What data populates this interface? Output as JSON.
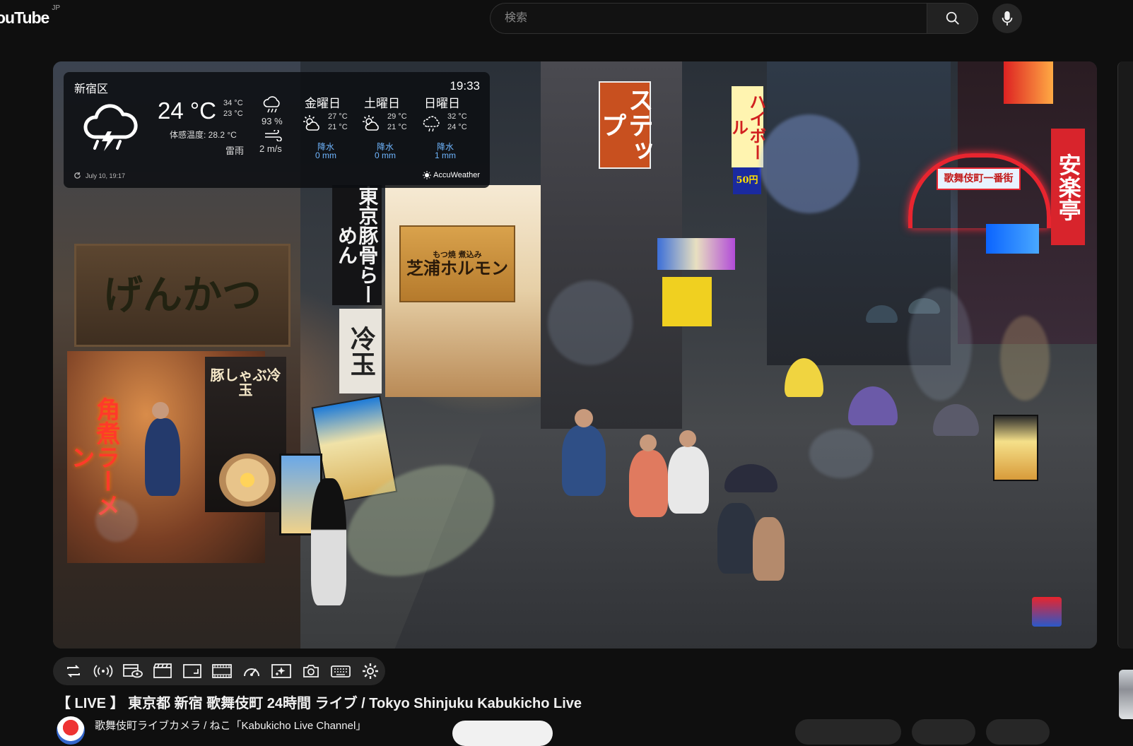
{
  "header": {
    "logo_text": "ouTube",
    "region": "JP",
    "search_placeholder": "検索",
    "search_icon": "search-icon",
    "mic_icon": "mic-icon"
  },
  "video": {
    "weather": {
      "location": "新宿区",
      "time": "19:33",
      "current_temp": "24 °C",
      "high": "34 °C",
      "low": "23 °C",
      "feels_like": "体感温度: 28.2 °C",
      "condition": "雷雨",
      "humidity": "93 %",
      "wind": "2 m/s",
      "forecast": [
        {
          "day": "金曜日",
          "high": "27 °C",
          "low": "21 °C",
          "precip_label": "降水",
          "precip": "0 mm"
        },
        {
          "day": "土曜日",
          "high": "29 °C",
          "low": "21 °C",
          "precip_label": "降水",
          "precip": "0 mm"
        },
        {
          "day": "日曜日",
          "high": "32 °C",
          "low": "24 °C",
          "precip_label": "降水",
          "precip": "1 mm"
        }
      ],
      "updated": "July 10, 19:17",
      "brand": "AccuWeather"
    },
    "scene_signs": {
      "ramen_shop": "げんかつ",
      "ramen_banner": "豚しゃぶ冷玉",
      "kakuni": "角煮ラーメン",
      "tokyo_ramen": "東京豚骨らーめん",
      "hormone_small": "もつ焼 煮込み",
      "hormone": "芝浦ホルモン",
      "cold": "冷玉",
      "step": "ステップ",
      "highball": "ハイボール",
      "highball_price": "50円",
      "kabukicho": "歌舞伎町一番街",
      "anrakutei": "安楽亭"
    }
  },
  "toolbar": {
    "buttons": [
      "repeat-icon",
      "broadcast-icon",
      "screen-eye-icon",
      "clapper-icon",
      "frame-icon",
      "film-strip-icon",
      "speedometer-icon",
      "sparkle-box-icon",
      "camera-icon",
      "keyboard-icon",
      "gear-icon"
    ]
  },
  "title": "【 LIVE 】 東京都 新宿 歌舞伎町 24時間 ライブ / Tokyo Shinjuku Kabukicho Live",
  "channel": {
    "name": "歌舞伎町ライブカメラ / ねこ「Kabukicho Live Channel」"
  },
  "colors": {
    "background": "#0f0f0f",
    "precip_blue": "#6fb6ff",
    "toolbar_bg": "#262626"
  }
}
